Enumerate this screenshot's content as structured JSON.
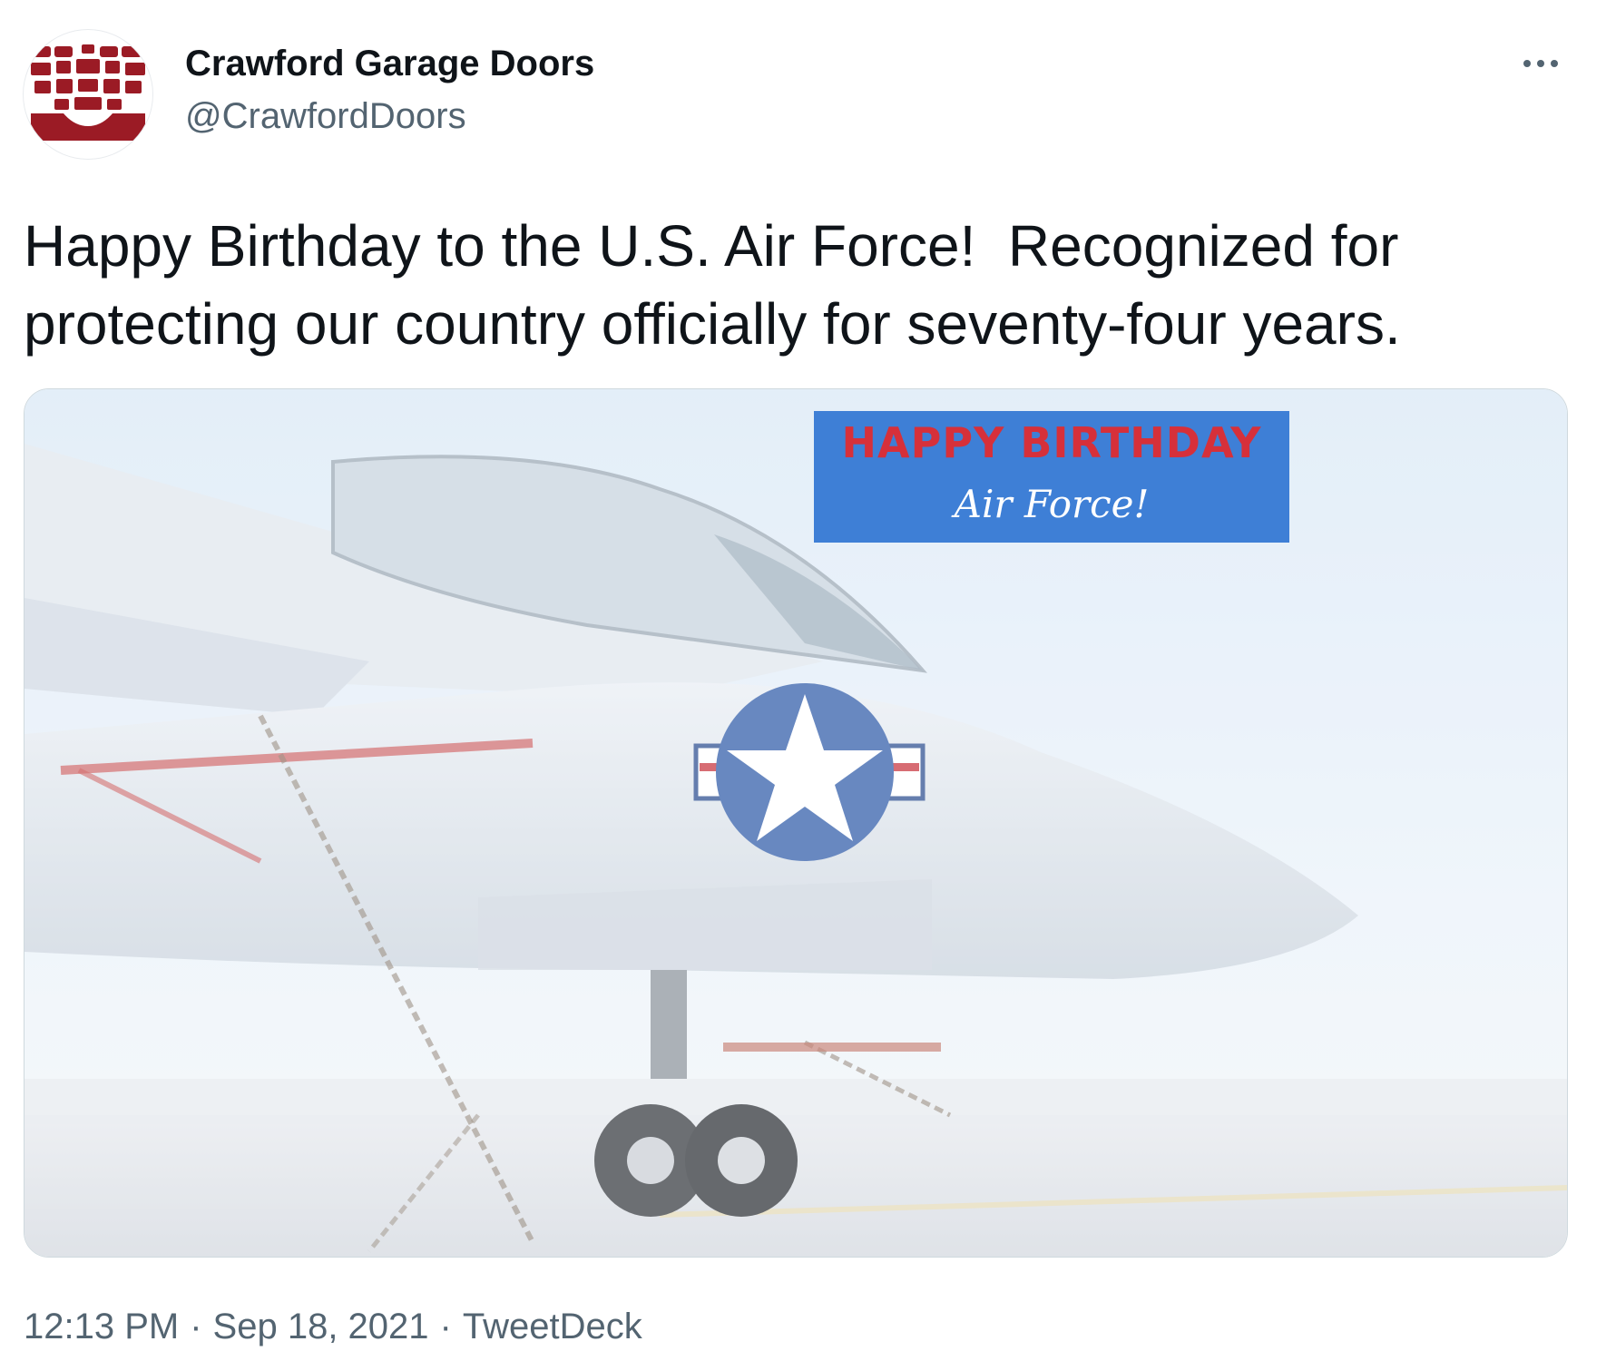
{
  "account": {
    "display_name": "Crawford Garage Doors",
    "handle": "@CrawfordDoors",
    "avatar_icon": "crawford-logo-icon",
    "brand_color": "#9b1b25"
  },
  "menu_icon": "more-horizontal-icon",
  "tweet": {
    "text": "Happy Birthday to the U.S. Air Force!  Recognized for\nprotecting our country officially for seventy-four years."
  },
  "media": {
    "banner_title": "HAPPY BIRTHDAY",
    "banner_subtitle": "Air Force!",
    "banner_color": "#3e7fd6",
    "banner_title_color": "#d6303a"
  },
  "meta": {
    "time": "12:13 PM",
    "date": "Sep 18, 2021",
    "source": "TweetDeck",
    "separator": "·"
  }
}
